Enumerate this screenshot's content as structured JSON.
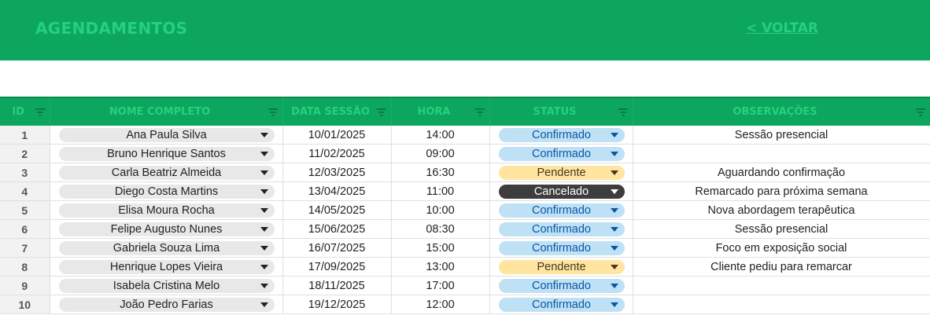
{
  "header": {
    "title": "AGENDAMENTOS",
    "back_label": "< VOLTAR"
  },
  "colors": {
    "header_bg": "#0ca65f",
    "header_text": "#26d07e",
    "confirmado_bg": "#bfe1f6",
    "pendente_bg": "#ffe5a0",
    "cancelado_bg": "#3d3d3d"
  },
  "table": {
    "columns": [
      "ID",
      "NOME COMPLETO",
      "DATA SESSÃO",
      "HORA",
      "STATUS",
      "OBSERVAÇÕES"
    ],
    "rows": [
      {
        "id": "1",
        "nome": "Ana Paula Silva",
        "data": "10/01/2025",
        "hora": "14:00",
        "status": "Confirmado",
        "obs": "Sessão presencial"
      },
      {
        "id": "2",
        "nome": "Bruno Henrique Santos",
        "data": "11/02/2025",
        "hora": "09:00",
        "status": "Confirmado",
        "obs": ""
      },
      {
        "id": "3",
        "nome": "Carla Beatriz Almeida",
        "data": "12/03/2025",
        "hora": "16:30",
        "status": "Pendente",
        "obs": "Aguardando confirmação"
      },
      {
        "id": "4",
        "nome": "Diego Costa Martins",
        "data": "13/04/2025",
        "hora": "11:00",
        "status": "Cancelado",
        "obs": "Remarcado para próxima semana"
      },
      {
        "id": "5",
        "nome": "Elisa Moura Rocha",
        "data": "14/05/2025",
        "hora": "10:00",
        "status": "Confirmado",
        "obs": "Nova abordagem terapêutica"
      },
      {
        "id": "6",
        "nome": "Felipe Augusto Nunes",
        "data": "15/06/2025",
        "hora": "08:30",
        "status": "Confirmado",
        "obs": "Sessão presencial"
      },
      {
        "id": "7",
        "nome": "Gabriela Souza Lima",
        "data": "16/07/2025",
        "hora": "15:00",
        "status": "Confirmado",
        "obs": "Foco em exposição social"
      },
      {
        "id": "8",
        "nome": "Henrique Lopes Vieira",
        "data": "17/09/2025",
        "hora": "13:00",
        "status": "Pendente",
        "obs": "Cliente pediu para remarcar"
      },
      {
        "id": "9",
        "nome": "Isabela Cristina Melo",
        "data": "18/11/2025",
        "hora": "17:00",
        "status": "Confirmado",
        "obs": ""
      },
      {
        "id": "10",
        "nome": "João Pedro Farias",
        "data": "19/12/2025",
        "hora": "12:00",
        "status": "Confirmado",
        "obs": ""
      }
    ]
  }
}
